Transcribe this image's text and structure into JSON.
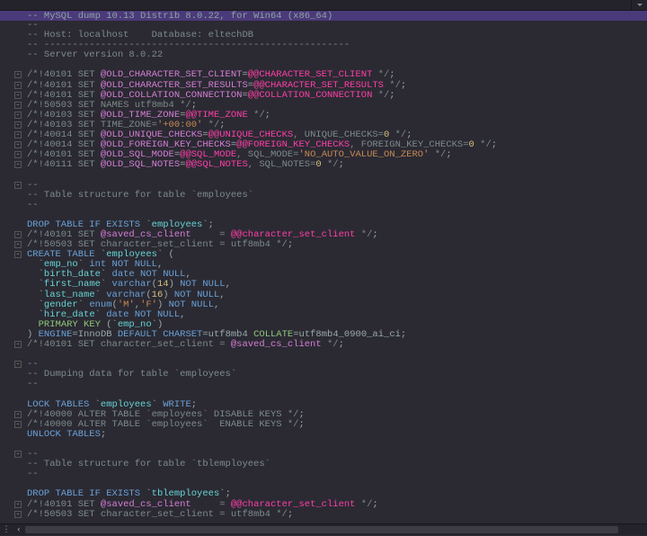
{
  "banner": "-- MySQL dump 10.13  Distrib 8.0.22, for Win64 (x86_64)",
  "lines": [
    {
      "tokens": [
        {
          "t": "--",
          "c": "c-c"
        }
      ]
    },
    {
      "tokens": [
        {
          "t": "-- Host: localhost    Database: eltechDB",
          "c": "c-c"
        }
      ]
    },
    {
      "tokens": [
        {
          "t": "-- ------------------------------------------------------",
          "c": "c-c"
        }
      ]
    },
    {
      "tokens": [
        {
          "t": "-- Server version 8.0.22",
          "c": "c-c"
        }
      ]
    },
    {
      "tokens": [
        {
          "t": " ",
          "c": "c-g"
        }
      ]
    },
    {
      "fold": true,
      "tokens": [
        {
          "t": "/*!40101 SET ",
          "c": "c-c"
        },
        {
          "t": "@OLD_CHARACTER_SET_CLIENT",
          "c": "c-v"
        },
        {
          "t": "=",
          "c": "c-g"
        },
        {
          "t": "@@CHARACTER_SET_CLIENT",
          "c": "c-m"
        },
        {
          "t": " */",
          "c": "c-c"
        },
        {
          "t": ";",
          "c": "c-g"
        }
      ]
    },
    {
      "fold": true,
      "tokens": [
        {
          "t": "/*!40101 SET ",
          "c": "c-c"
        },
        {
          "t": "@OLD_CHARACTER_SET_RESULTS",
          "c": "c-v"
        },
        {
          "t": "=",
          "c": "c-g"
        },
        {
          "t": "@@CHARACTER_SET_RESULTS",
          "c": "c-m"
        },
        {
          "t": " */",
          "c": "c-c"
        },
        {
          "t": ";",
          "c": "c-g"
        }
      ]
    },
    {
      "fold": true,
      "tokens": [
        {
          "t": "/*!40101 SET ",
          "c": "c-c"
        },
        {
          "t": "@OLD_COLLATION_CONNECTION",
          "c": "c-v"
        },
        {
          "t": "=",
          "c": "c-g"
        },
        {
          "t": "@@COLLATION_CONNECTION",
          "c": "c-m"
        },
        {
          "t": " */",
          "c": "c-c"
        },
        {
          "t": ";",
          "c": "c-g"
        }
      ]
    },
    {
      "fold": true,
      "tokens": [
        {
          "t": "/*!50503 SET NAMES utf8mb4 */",
          "c": "c-c"
        },
        {
          "t": ";",
          "c": "c-g"
        }
      ]
    },
    {
      "fold": true,
      "tokens": [
        {
          "t": "/*!40103 SET ",
          "c": "c-c"
        },
        {
          "t": "@OLD_TIME_ZONE",
          "c": "c-v"
        },
        {
          "t": "=",
          "c": "c-g"
        },
        {
          "t": "@@TIME_ZONE",
          "c": "c-m"
        },
        {
          "t": " */",
          "c": "c-c"
        },
        {
          "t": ";",
          "c": "c-g"
        }
      ]
    },
    {
      "fold": true,
      "tokens": [
        {
          "t": "/*!40103 SET TIME_ZONE=",
          "c": "c-c"
        },
        {
          "t": "'+00:00'",
          "c": "c-s"
        },
        {
          "t": " */",
          "c": "c-c"
        },
        {
          "t": ";",
          "c": "c-g"
        }
      ]
    },
    {
      "fold": true,
      "tokens": [
        {
          "t": "/*!40014 SET ",
          "c": "c-c"
        },
        {
          "t": "@OLD_UNIQUE_CHECKS",
          "c": "c-v"
        },
        {
          "t": "=",
          "c": "c-g"
        },
        {
          "t": "@@UNIQUE_CHECKS",
          "c": "c-m"
        },
        {
          "t": ", UNIQUE_CHECKS=",
          "c": "c-c"
        },
        {
          "t": "0",
          "c": "c-n"
        },
        {
          "t": " */",
          "c": "c-c"
        },
        {
          "t": ";",
          "c": "c-g"
        }
      ]
    },
    {
      "fold": true,
      "tokens": [
        {
          "t": "/*!40014 SET ",
          "c": "c-c"
        },
        {
          "t": "@OLD_FOREIGN_KEY_CHECKS",
          "c": "c-v"
        },
        {
          "t": "=",
          "c": "c-g"
        },
        {
          "t": "@@FOREIGN_KEY_CHECKS",
          "c": "c-m"
        },
        {
          "t": ", FOREIGN_KEY_CHECKS=",
          "c": "c-c"
        },
        {
          "t": "0",
          "c": "c-n"
        },
        {
          "t": " */",
          "c": "c-c"
        },
        {
          "t": ";",
          "c": "c-g"
        }
      ]
    },
    {
      "fold": true,
      "tokens": [
        {
          "t": "/*!40101 SET ",
          "c": "c-c"
        },
        {
          "t": "@OLD_SQL_MODE",
          "c": "c-v"
        },
        {
          "t": "=",
          "c": "c-g"
        },
        {
          "t": "@@SQL_MODE",
          "c": "c-m"
        },
        {
          "t": ", SQL_MODE=",
          "c": "c-c"
        },
        {
          "t": "'NO_AUTO_VALUE_ON_ZERO'",
          "c": "c-s"
        },
        {
          "t": " */",
          "c": "c-c"
        },
        {
          "t": ";",
          "c": "c-g"
        }
      ]
    },
    {
      "fold": true,
      "tokens": [
        {
          "t": "/*!40111 SET ",
          "c": "c-c"
        },
        {
          "t": "@OLD_SQL_NOTES",
          "c": "c-v"
        },
        {
          "t": "=",
          "c": "c-g"
        },
        {
          "t": "@@SQL_NOTES",
          "c": "c-m"
        },
        {
          "t": ", SQL_NOTES=",
          "c": "c-c"
        },
        {
          "t": "0",
          "c": "c-n"
        },
        {
          "t": " */",
          "c": "c-c"
        },
        {
          "t": ";",
          "c": "c-g"
        }
      ]
    },
    {
      "tokens": [
        {
          "t": " ",
          "c": "c-g"
        }
      ]
    },
    {
      "fold": true,
      "tokens": [
        {
          "t": "--",
          "c": "c-c"
        }
      ]
    },
    {
      "tokens": [
        {
          "t": "-- Table structure for table `employees`",
          "c": "c-c"
        }
      ]
    },
    {
      "tokens": [
        {
          "t": "--",
          "c": "c-c"
        }
      ]
    },
    {
      "tokens": [
        {
          "t": " ",
          "c": "c-g"
        }
      ]
    },
    {
      "tokens": [
        {
          "t": "DROP TABLE IF EXISTS",
          "c": "c-b"
        },
        {
          "t": " `",
          "c": "c-g"
        },
        {
          "t": "employees",
          "c": "c-t"
        },
        {
          "t": "`;",
          "c": "c-g"
        }
      ]
    },
    {
      "fold": true,
      "tokens": [
        {
          "t": "/*!40101 SET ",
          "c": "c-c"
        },
        {
          "t": "@saved_cs_client",
          "c": "c-v"
        },
        {
          "t": "     = ",
          "c": "c-c"
        },
        {
          "t": "@@character_set_client",
          "c": "c-m"
        },
        {
          "t": " */",
          "c": "c-c"
        },
        {
          "t": ";",
          "c": "c-g"
        }
      ]
    },
    {
      "fold": true,
      "tokens": [
        {
          "t": "/*!50503 SET character_set_client = utf8mb4 */",
          "c": "c-c"
        },
        {
          "t": ";",
          "c": "c-g"
        }
      ]
    },
    {
      "fold": true,
      "tokens": [
        {
          "t": "CREATE TABLE",
          "c": "c-b"
        },
        {
          "t": " `",
          "c": "c-g"
        },
        {
          "t": "employees",
          "c": "c-t"
        },
        {
          "t": "` (",
          "c": "c-g"
        }
      ]
    },
    {
      "tokens": [
        {
          "t": "  `",
          "c": "c-g"
        },
        {
          "t": "emp_no",
          "c": "c-t"
        },
        {
          "t": "` ",
          "c": "c-g"
        },
        {
          "t": "int NOT NULL",
          "c": "c-b"
        },
        {
          "t": ",",
          "c": "c-g"
        }
      ]
    },
    {
      "tokens": [
        {
          "t": "  `",
          "c": "c-g"
        },
        {
          "t": "birth_date",
          "c": "c-t"
        },
        {
          "t": "` ",
          "c": "c-g"
        },
        {
          "t": "date NOT NULL",
          "c": "c-b"
        },
        {
          "t": ",",
          "c": "c-g"
        }
      ]
    },
    {
      "tokens": [
        {
          "t": "  `",
          "c": "c-g"
        },
        {
          "t": "first_name",
          "c": "c-t"
        },
        {
          "t": "` ",
          "c": "c-g"
        },
        {
          "t": "varchar",
          "c": "c-b"
        },
        {
          "t": "(",
          "c": "c-g"
        },
        {
          "t": "14",
          "c": "c-n"
        },
        {
          "t": ") ",
          "c": "c-g"
        },
        {
          "t": "NOT NULL",
          "c": "c-b"
        },
        {
          "t": ",",
          "c": "c-g"
        }
      ]
    },
    {
      "tokens": [
        {
          "t": "  `",
          "c": "c-g"
        },
        {
          "t": "last_name",
          "c": "c-t"
        },
        {
          "t": "` ",
          "c": "c-g"
        },
        {
          "t": "varchar",
          "c": "c-b"
        },
        {
          "t": "(",
          "c": "c-g"
        },
        {
          "t": "16",
          "c": "c-n"
        },
        {
          "t": ") ",
          "c": "c-g"
        },
        {
          "t": "NOT NULL",
          "c": "c-b"
        },
        {
          "t": ",",
          "c": "c-g"
        }
      ]
    },
    {
      "tokens": [
        {
          "t": "  `",
          "c": "c-g"
        },
        {
          "t": "gender",
          "c": "c-t"
        },
        {
          "t": "` ",
          "c": "c-g"
        },
        {
          "t": "enum",
          "c": "c-b"
        },
        {
          "t": "(",
          "c": "c-g"
        },
        {
          "t": "'M'",
          "c": "c-s"
        },
        {
          "t": ",",
          "c": "c-g"
        },
        {
          "t": "'F'",
          "c": "c-s"
        },
        {
          "t": ") ",
          "c": "c-g"
        },
        {
          "t": "NOT NULL",
          "c": "c-b"
        },
        {
          "t": ",",
          "c": "c-g"
        }
      ]
    },
    {
      "tokens": [
        {
          "t": "  `",
          "c": "c-g"
        },
        {
          "t": "hire_date",
          "c": "c-t"
        },
        {
          "t": "` ",
          "c": "c-g"
        },
        {
          "t": "date NOT NULL",
          "c": "c-b"
        },
        {
          "t": ",",
          "c": "c-g"
        }
      ]
    },
    {
      "tokens": [
        {
          "t": "  ",
          "c": "c-g"
        },
        {
          "t": "PRIMARY KEY",
          "c": "c-gr"
        },
        {
          "t": " (`",
          "c": "c-g"
        },
        {
          "t": "emp_no",
          "c": "c-t"
        },
        {
          "t": "`)",
          "c": "c-g"
        }
      ]
    },
    {
      "tokens": [
        {
          "t": ") ",
          "c": "c-g"
        },
        {
          "t": "ENGINE",
          "c": "c-b"
        },
        {
          "t": "=",
          "c": "c-g"
        },
        {
          "t": "InnoDB ",
          "c": "c-g"
        },
        {
          "t": "DEFAULT CHARSET",
          "c": "c-b"
        },
        {
          "t": "=",
          "c": "c-g"
        },
        {
          "t": "utf8mb4 ",
          "c": "c-g"
        },
        {
          "t": "COLLATE",
          "c": "c-gr"
        },
        {
          "t": "=",
          "c": "c-g"
        },
        {
          "t": "utf8mb4_0900_ai_ci;",
          "c": "c-g"
        }
      ]
    },
    {
      "fold": true,
      "tokens": [
        {
          "t": "/*!40101 SET character_set_client = ",
          "c": "c-c"
        },
        {
          "t": "@saved_cs_client",
          "c": "c-v"
        },
        {
          "t": " */",
          "c": "c-c"
        },
        {
          "t": ";",
          "c": "c-g"
        }
      ]
    },
    {
      "tokens": [
        {
          "t": " ",
          "c": "c-g"
        }
      ]
    },
    {
      "fold": true,
      "tokens": [
        {
          "t": "--",
          "c": "c-c"
        }
      ]
    },
    {
      "tokens": [
        {
          "t": "-- Dumping data for table `employees`",
          "c": "c-c"
        }
      ]
    },
    {
      "tokens": [
        {
          "t": "--",
          "c": "c-c"
        }
      ]
    },
    {
      "tokens": [
        {
          "t": " ",
          "c": "c-g"
        }
      ]
    },
    {
      "tokens": [
        {
          "t": "LOCK TABLES",
          "c": "c-b"
        },
        {
          "t": " `",
          "c": "c-g"
        },
        {
          "t": "employees",
          "c": "c-t"
        },
        {
          "t": "` ",
          "c": "c-g"
        },
        {
          "t": "WRITE",
          "c": "c-b"
        },
        {
          "t": ";",
          "c": "c-g"
        }
      ]
    },
    {
      "fold": true,
      "tokens": [
        {
          "t": "/*!40000 ALTER TABLE `employees` DISABLE KEYS */",
          "c": "c-c"
        },
        {
          "t": ";",
          "c": "c-g"
        }
      ]
    },
    {
      "fold": true,
      "tokens": [
        {
          "t": "/*!40000 ALTER TABLE `employees`  ENABLE KEYS */",
          "c": "c-c"
        },
        {
          "t": ";",
          "c": "c-g"
        }
      ]
    },
    {
      "tokens": [
        {
          "t": "UNLOCK TABLES",
          "c": "c-b"
        },
        {
          "t": ";",
          "c": "c-g"
        }
      ]
    },
    {
      "tokens": [
        {
          "t": " ",
          "c": "c-g"
        }
      ]
    },
    {
      "fold": true,
      "tokens": [
        {
          "t": "--",
          "c": "c-c"
        }
      ]
    },
    {
      "tokens": [
        {
          "t": "-- Table structure for table `tblemployees`",
          "c": "c-c"
        }
      ]
    },
    {
      "tokens": [
        {
          "t": "--",
          "c": "c-c"
        }
      ]
    },
    {
      "tokens": [
        {
          "t": " ",
          "c": "c-g"
        }
      ]
    },
    {
      "tokens": [
        {
          "t": "DROP TABLE IF EXISTS",
          "c": "c-b"
        },
        {
          "t": " `",
          "c": "c-g"
        },
        {
          "t": "tblemployees",
          "c": "c-t"
        },
        {
          "t": "`;",
          "c": "c-g"
        }
      ]
    },
    {
      "fold": true,
      "tokens": [
        {
          "t": "/*!40101 SET ",
          "c": "c-c"
        },
        {
          "t": "@saved_cs_client",
          "c": "c-v"
        },
        {
          "t": "     = ",
          "c": "c-c"
        },
        {
          "t": "@@character_set_client",
          "c": "c-m"
        },
        {
          "t": " */",
          "c": "c-c"
        },
        {
          "t": ";",
          "c": "c-g"
        }
      ]
    },
    {
      "fold": true,
      "tokens": [
        {
          "t": "/*!50503 SET character_set_client = utf8mb4 */",
          "c": "c-c"
        },
        {
          "t": ";",
          "c": "c-g"
        }
      ]
    }
  ]
}
